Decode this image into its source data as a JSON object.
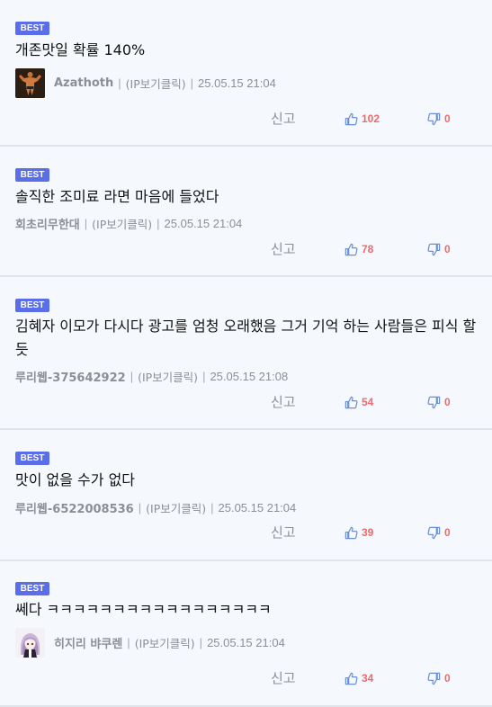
{
  "comments": [
    {
      "badge": "BEST",
      "text": "개존맛일 확률 140%",
      "nickname": "Azathoth",
      "has_avatar": true,
      "avatar_icon": "bodybuilder-avatar-icon",
      "ip_info": "(IP보기클릭)",
      "datetime": "25.05.15 21:04",
      "report_label": "신고",
      "likes": "102",
      "dislikes": "0"
    },
    {
      "badge": "BEST",
      "text": "솔직한 조미료 라면 마음에 들었다",
      "nickname": "회초리무한대",
      "has_avatar": false,
      "ip_info": "(IP보기클릭)",
      "datetime": "25.05.15 21:04",
      "report_label": "신고",
      "likes": "78",
      "dislikes": "0"
    },
    {
      "badge": "BEST",
      "text": "김혜자 이모가 다시다 광고를 엄청 오래했음 그거 기억 하는 사람들은 피식 할듯",
      "nickname": "루리웹-375642922",
      "has_avatar": false,
      "ip_info": "(IP보기클릭)",
      "datetime": "25.05.15 21:08",
      "report_label": "신고",
      "likes": "54",
      "dislikes": "0"
    },
    {
      "badge": "BEST",
      "text": "맛이 없을 수가 없다",
      "nickname": "루리웹-6522008536",
      "has_avatar": false,
      "ip_info": "(IP보기클릭)",
      "datetime": "25.05.15 21:04",
      "report_label": "신고",
      "likes": "39",
      "dislikes": "0"
    },
    {
      "badge": "BEST",
      "text": "쎄다 ㅋㅋㅋㅋㅋㅋㅋㅋㅋㅋㅋㅋㅋㅋㅋㅋㅋ",
      "nickname": "히지리 뱌쿠렌",
      "has_avatar": true,
      "avatar_icon": "anime-character-avatar-icon",
      "ip_info": "(IP보기클릭)",
      "datetime": "25.05.15 21:04",
      "report_label": "신고",
      "likes": "34",
      "dislikes": "0"
    }
  ],
  "colors": {
    "background": "#f5f8fc",
    "badge": "#5b6ee9",
    "vote_count": "#ef6a6a",
    "vote_icon": "#6b8fd6",
    "meta_text": "#8c8f96",
    "divider": "#dfe3ea"
  },
  "icons": {
    "like": "thumbs-up-icon",
    "dislike": "thumbs-down-icon"
  }
}
